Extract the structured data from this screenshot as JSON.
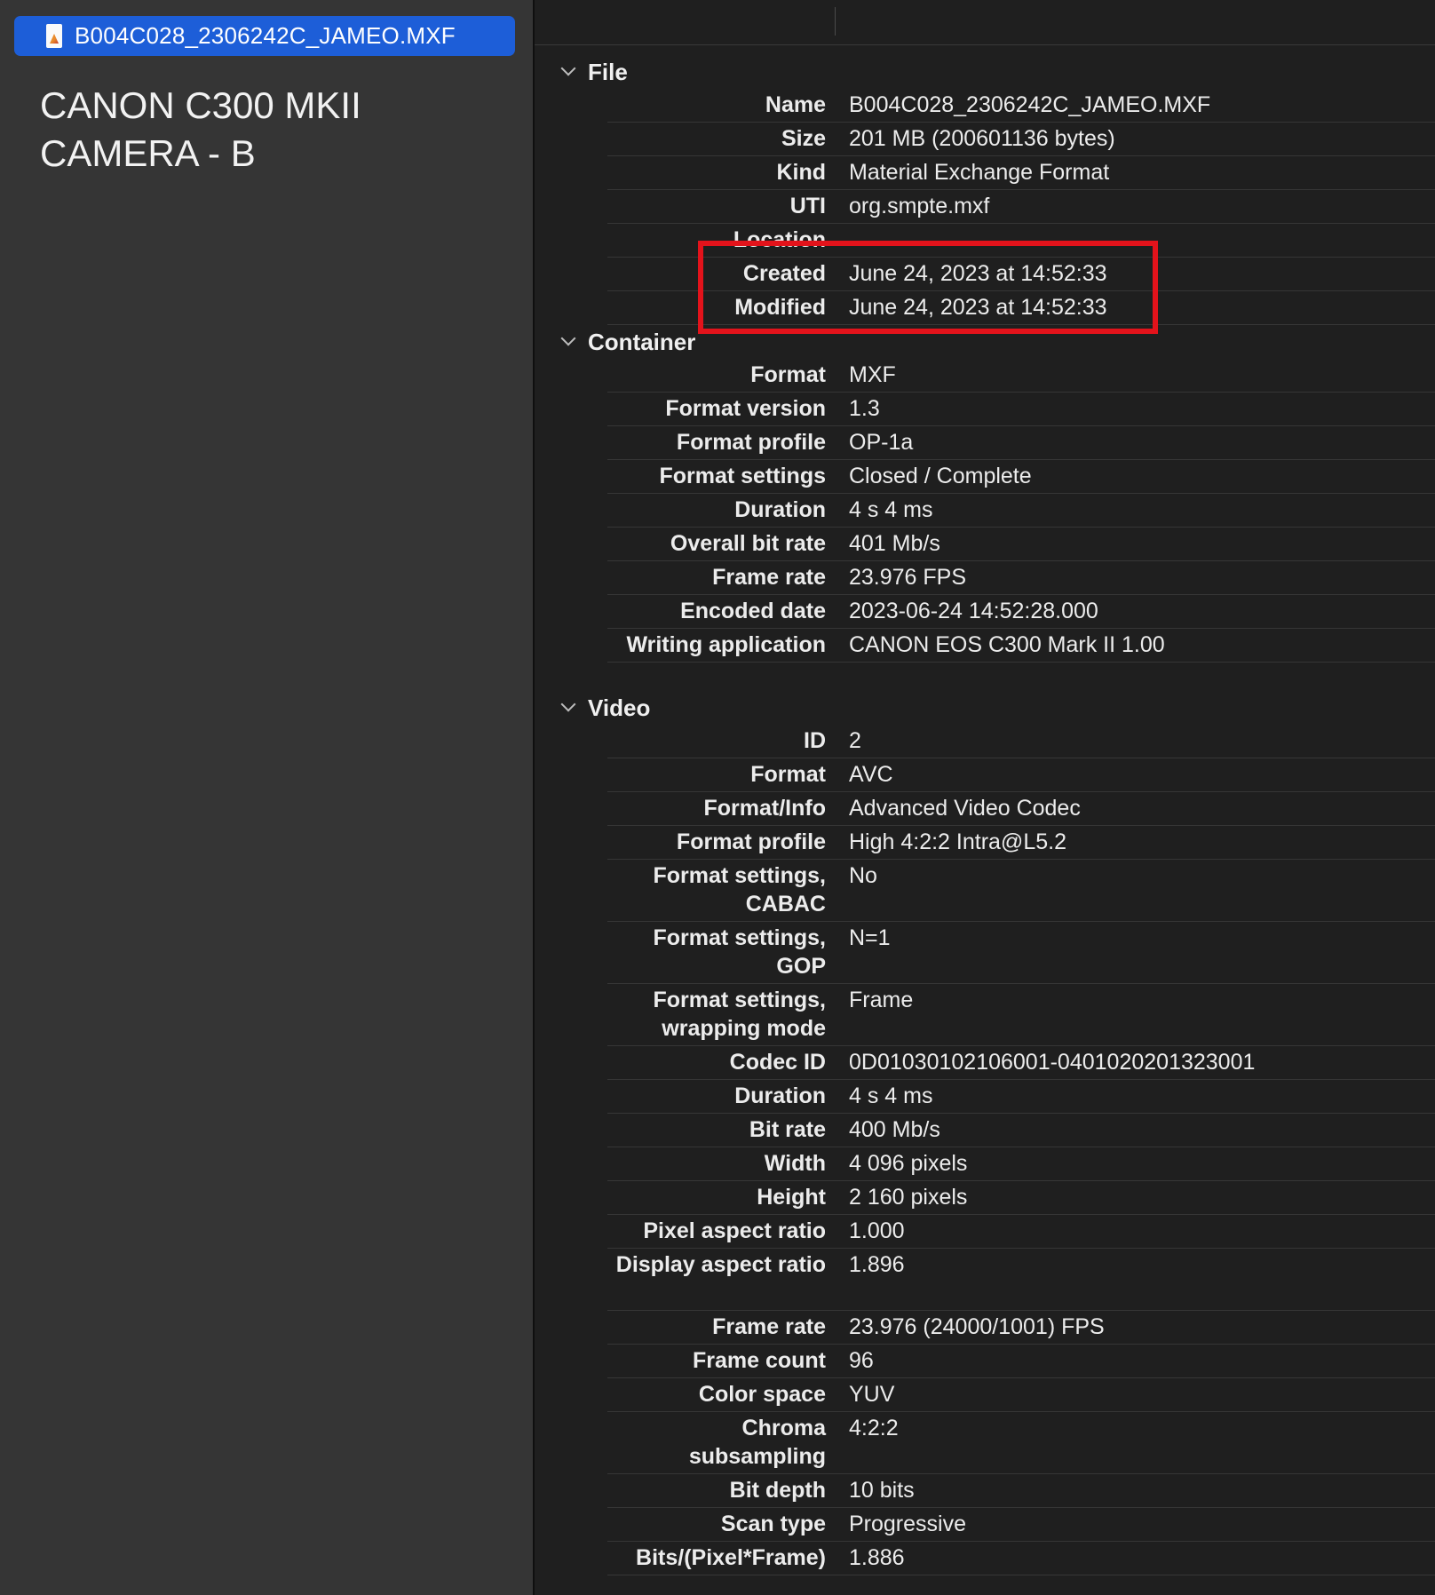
{
  "sidebar": {
    "file_name": "B004C028_2306242C_JAMEO.MXF",
    "note_line1": "CANON C300 MKII",
    "note_line2": "CAMERA - B"
  },
  "sections": [
    {
      "title": "File",
      "rows": [
        {
          "k": "Name",
          "v": "B004C028_2306242C_JAMEO.MXF"
        },
        {
          "k": "Size",
          "v": "201 MB (200601136 bytes)"
        },
        {
          "k": "Kind",
          "v": "Material Exchange Format"
        },
        {
          "k": "UTI",
          "v": "org.smpte.mxf"
        },
        {
          "k": "Location",
          "v": ""
        },
        {
          "k": "Created",
          "v": "June 24, 2023 at 14:52:33"
        },
        {
          "k": "Modified",
          "v": "June 24, 2023 at 14:52:33"
        }
      ]
    },
    {
      "title": "Container",
      "rows": [
        {
          "k": "Format",
          "v": "MXF"
        },
        {
          "k": "Format version",
          "v": "1.3"
        },
        {
          "k": "Format profile",
          "v": "OP-1a"
        },
        {
          "k": "Format settings",
          "v": "Closed / Complete"
        },
        {
          "k": "Duration",
          "v": "4 s 4 ms"
        },
        {
          "k": "Overall bit rate",
          "v": "401 Mb/s"
        },
        {
          "k": "Frame rate",
          "v": "23.976 FPS"
        },
        {
          "k": "Encoded date",
          "v": "2023-06-24 14:52:28.000"
        },
        {
          "k": "Writing application",
          "v": "CANON EOS C300 Mark II 1.00"
        }
      ]
    },
    {
      "title": "Video",
      "rows": [
        {
          "k": "ID",
          "v": "2"
        },
        {
          "k": "Format",
          "v": "AVC"
        },
        {
          "k": "Format/Info",
          "v": "Advanced Video Codec"
        },
        {
          "k": "Format profile",
          "v": "High 4:2:2 Intra@L5.2"
        },
        {
          "k": "Format settings, CABAC",
          "v": "No"
        },
        {
          "k": "Format settings, GOP",
          "v": "N=1"
        },
        {
          "k": "Format settings, wrapping mode",
          "v": "Frame"
        },
        {
          "k": "Codec ID",
          "v": "0D01030102106001-0401020201323001"
        },
        {
          "k": "Duration",
          "v": "4 s 4 ms"
        },
        {
          "k": "Bit rate",
          "v": "400 Mb/s"
        },
        {
          "k": "Width",
          "v": "4 096 pixels"
        },
        {
          "k": "Height",
          "v": "2 160 pixels"
        },
        {
          "k": "Pixel aspect ratio",
          "v": "1.000"
        },
        {
          "k": "Display aspect ratio",
          "v": "1.896"
        },
        {
          "k": "Frame rate",
          "v": "23.976 (24000/1001) FPS"
        },
        {
          "k": "Frame count",
          "v": "96"
        },
        {
          "k": "Color space",
          "v": "YUV"
        },
        {
          "k": "Chroma subsampling",
          "v": "4:2:2"
        },
        {
          "k": "Bit depth",
          "v": "10 bits"
        },
        {
          "k": "Scan type",
          "v": "Progressive"
        },
        {
          "k": "Bits/(Pixel*Frame)",
          "v": "1.886"
        }
      ]
    }
  ],
  "highlight_color": "#e3131b",
  "accent": "#1d5ed8"
}
